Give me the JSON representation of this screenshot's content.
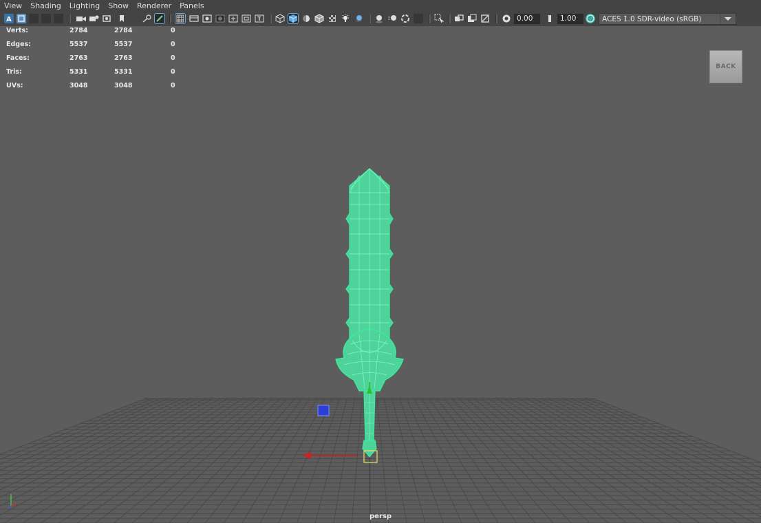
{
  "menubar": {
    "items": [
      "View",
      "Shading",
      "Lighting",
      "Show",
      "Renderer",
      "Panels"
    ]
  },
  "toolbar": {
    "gamma_value": "0.00",
    "exposure_value": "1.00",
    "colorspace": "ACES 1.0 SDR-video (sRGB)",
    "icons": [
      "select-camera-icon",
      "camera-attributes-icon",
      "bookmark-icon",
      "image-plane-icon",
      "two-d-pan-icon",
      "grease-pencil-icon",
      "grid-icon",
      "film-gate-icon",
      "resolution-gate-icon",
      "gate-mask-icon",
      "field-chart-icon",
      "safe-action-icon",
      "safe-title-icon",
      "wireframe-icon",
      "smooth-shade-icon",
      "use-default-material-icon",
      "wireframe-on-shaded-icon",
      "textured-icon",
      "use-all-lights-icon",
      "shadows-icon",
      "screen-space-ao-icon",
      "motion-blur-icon",
      "multisample-aa-icon",
      "depth-of-field-icon",
      "isolate-select-icon",
      "xray-icon",
      "xray-joints-icon",
      "backface-culling-icon",
      "exposure-icon",
      "gamma-icon",
      "color-management-icon"
    ]
  },
  "hud": {
    "rows": [
      {
        "label": "Verts:",
        "a": "2784",
        "b": "2784",
        "c": "0"
      },
      {
        "label": "Edges:",
        "a": "5537",
        "b": "5537",
        "c": "0"
      },
      {
        "label": "Faces:",
        "a": "2763",
        "b": "2763",
        "c": "0"
      },
      {
        "label": "Tris:",
        "a": "5331",
        "b": "5331",
        "c": "0"
      },
      {
        "label": "UVs:",
        "a": "3048",
        "b": "3048",
        "c": "0"
      }
    ]
  },
  "viewcube": {
    "label": "BACK"
  },
  "camera": {
    "name": "persp"
  },
  "colors": {
    "viewport_bg": "#5d5d5d",
    "toolbar_bg": "#444444",
    "wireframe": "#35f0a0",
    "mesh_fill": "#4fd39a",
    "grid_line": "#4a4a4a",
    "manip_x": "#d02020",
    "manip_y": "#30c030",
    "manip_z": "#2b3fd8"
  }
}
